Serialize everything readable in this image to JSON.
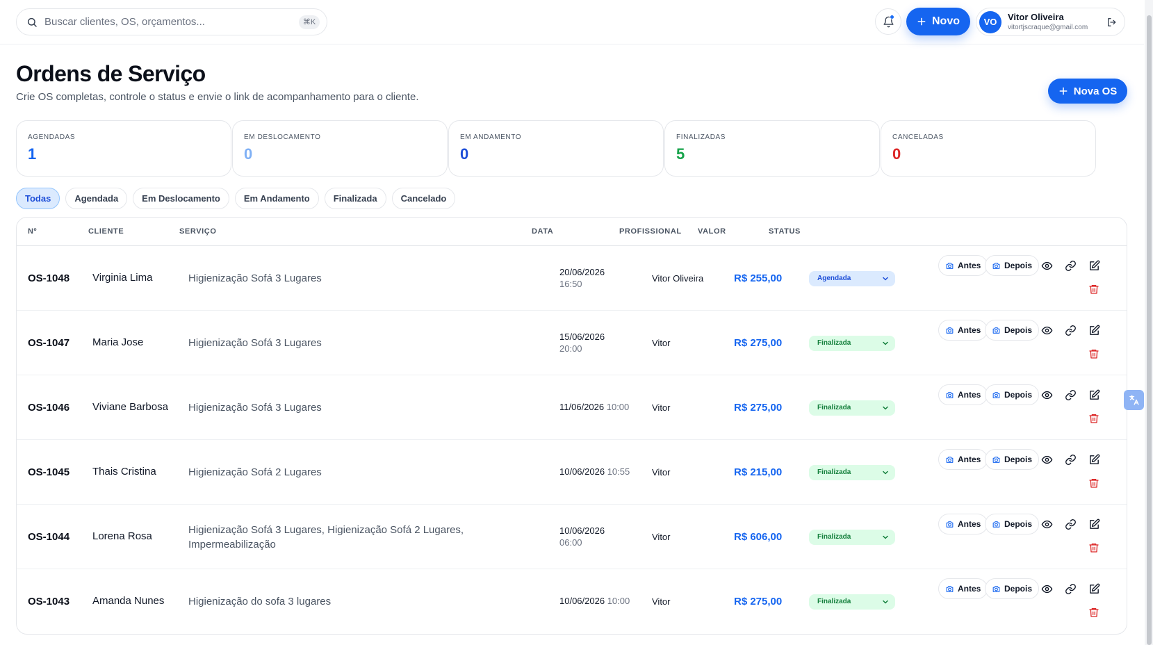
{
  "search": {
    "placeholder": "Buscar clientes, OS, orçamentos...",
    "shortcut": "⌘K"
  },
  "topbar": {
    "new_label": "Novo"
  },
  "user": {
    "initials": "VO",
    "name": "Vitor Oliveira",
    "email": "vitortjscraque@gmail.com"
  },
  "header": {
    "title": "Ordens de Serviço",
    "subtitle": "Crie OS completas, controle o status e envie o link de acompanhamento para o cliente.",
    "new_os_label": "Nova OS"
  },
  "stats": [
    {
      "label": "AGENDADAS",
      "value": "1",
      "color": "#1565f0"
    },
    {
      "label": "EM DESLOCAMENTO",
      "value": "0",
      "color": "#7fb0f5"
    },
    {
      "label": "EM ANDAMENTO",
      "value": "0",
      "color": "#1d4ed8"
    },
    {
      "label": "FINALIZADAS",
      "value": "5",
      "color": "#16a34a"
    },
    {
      "label": "CANCELADAS",
      "value": "0",
      "color": "#dc2626"
    }
  ],
  "filters": [
    "Todas",
    "Agendada",
    "Em Deslocamento",
    "Em Andamento",
    "Finalizada",
    "Cancelado"
  ],
  "table": {
    "headers": {
      "num": "Nº",
      "client": "CLIENTE",
      "service": "SERVIÇO",
      "date": "DATA",
      "professional": "PROFISSIONAL",
      "value": "VALOR",
      "status": "STATUS"
    },
    "photo_before": "Antes",
    "photo_after": "Depois",
    "rows": [
      {
        "num": "OS-1048",
        "client": "Virginia Lima",
        "service": "Higienização Sofá 3 Lugares",
        "date": "20/06/2026",
        "time": "16:50",
        "professional": "Vitor Oliveira",
        "value": "R$ 255,00",
        "status": "Agendada"
      },
      {
        "num": "OS-1047",
        "client": "Maria Jose",
        "service": "Higienização Sofá 3 Lugares",
        "date": "15/06/2026",
        "time": "20:00",
        "professional": "Vitor",
        "value": "R$ 275,00",
        "status": "Finalizada"
      },
      {
        "num": "OS-1046",
        "client": "Viviane Barbosa",
        "service": "Higienização Sofá 3 Lugares",
        "date": "11/06/2026",
        "time": "10:00",
        "professional": "Vitor",
        "value": "R$ 275,00",
        "status": "Finalizada"
      },
      {
        "num": "OS-1045",
        "client": "Thais Cristina",
        "service": "Higienização Sofá 2 Lugares",
        "date": "10/06/2026",
        "time": "10:55",
        "professional": "Vitor",
        "value": "R$ 215,00",
        "status": "Finalizada"
      },
      {
        "num": "OS-1044",
        "client": "Lorena Rosa",
        "service": "Higienização Sofá 3 Lugares, Higienização Sofá 2 Lugares, Impermeabilização",
        "date": "10/06/2026",
        "time": "06:00",
        "professional": "Vitor",
        "value": "R$ 606,00",
        "status": "Finalizada"
      },
      {
        "num": "OS-1043",
        "client": "Amanda Nunes",
        "service": "Higienização do sofa 3 lugares",
        "date": "10/06/2026",
        "time": "10:00",
        "professional": "Vitor",
        "value": "R$ 275,00",
        "status": "Finalizada"
      }
    ]
  }
}
